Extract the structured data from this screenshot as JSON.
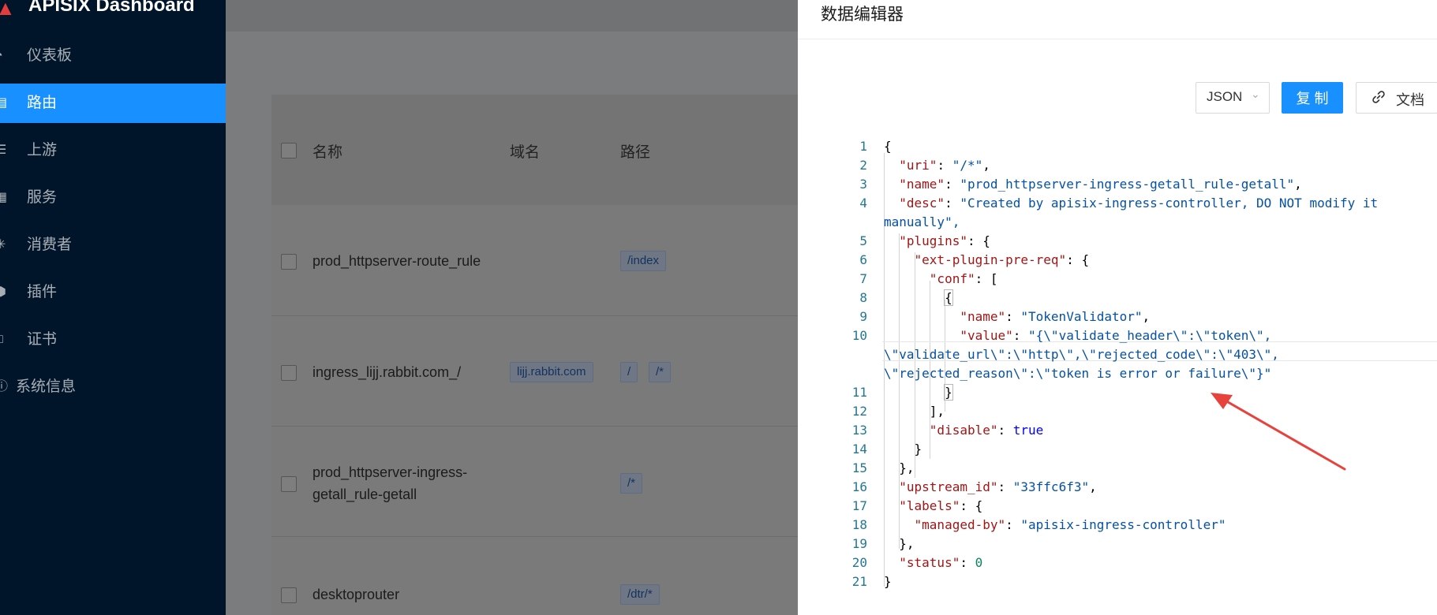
{
  "sidebar": {
    "brand": "APISIX Dashboard",
    "items": [
      {
        "label": "仪表板",
        "icon": "dashboard-icon"
      },
      {
        "label": "路由",
        "icon": "route-icon",
        "active": true
      },
      {
        "label": "上游",
        "icon": "upstream-icon"
      },
      {
        "label": "服务",
        "icon": "service-icon"
      },
      {
        "label": "消费者",
        "icon": "consumer-icon"
      },
      {
        "label": "插件",
        "icon": "plugin-icon"
      },
      {
        "label": "证书",
        "icon": "certificate-icon"
      },
      {
        "label": "系统信息",
        "icon": "info-icon"
      }
    ]
  },
  "table": {
    "columns": [
      "名称",
      "域名",
      "路径"
    ],
    "rows": [
      {
        "name": "prod_httpserver-route_rule",
        "host": "",
        "paths": [
          "/index"
        ]
      },
      {
        "name": "ingress_lijj.rabbit.com_/",
        "host": "lijj.rabbit.com",
        "paths": [
          "/",
          "/*"
        ]
      },
      {
        "name_line1": "prod_httpserver-ingress-",
        "name_line2": "getall_rule-getall",
        "host": "",
        "paths": [
          "/*"
        ]
      },
      {
        "name": "desktoprouter",
        "host": "",
        "paths": [
          "/dtr/*"
        ]
      }
    ]
  },
  "drawer": {
    "title": "数据编辑器",
    "format_select": "JSON",
    "copy_label": "复 制",
    "doc_label": "文档",
    "code_lines": [
      {
        "no": "1",
        "text": "{"
      },
      {
        "no": "2",
        "text": "  \"uri\": \"/*\","
      },
      {
        "no": "3",
        "text": "  \"name\": \"prod_httpserver-ingress-getall_rule-getall\","
      },
      {
        "no": "4",
        "text": "  \"desc\": \"Created by apisix-ingress-controller, DO NOT modify it"
      },
      {
        "no": "",
        "text": "manually\","
      },
      {
        "no": "5",
        "text": "  \"plugins\": {"
      },
      {
        "no": "6",
        "text": "    \"ext-plugin-pre-req\": {"
      },
      {
        "no": "7",
        "text": "      \"conf\": ["
      },
      {
        "no": "8",
        "text": "        {"
      },
      {
        "no": "9",
        "text": "          \"name\": \"TokenValidator\","
      },
      {
        "no": "10",
        "text": "          \"value\": \"{\\\"validate_header\\\":\\\"token\\\","
      },
      {
        "no": "",
        "text": "\\\"validate_url\\\":\\\"http\\\",\\\"rejected_code\\\":\\\"403\\\","
      },
      {
        "no": "",
        "text": "\\\"rejected_reason\\\":\\\"token is error or failure\\\"}\""
      },
      {
        "no": "11",
        "text": "        }"
      },
      {
        "no": "12",
        "text": "      ],"
      },
      {
        "no": "13",
        "text": "      \"disable\": true"
      },
      {
        "no": "14",
        "text": "    }"
      },
      {
        "no": "15",
        "text": "  },"
      },
      {
        "no": "16",
        "text": "  \"upstream_id\": \"33ffc6f3\","
      },
      {
        "no": "17",
        "text": "  \"labels\": {"
      },
      {
        "no": "18",
        "text": "    \"managed-by\": \"apisix-ingress-controller\""
      },
      {
        "no": "19",
        "text": "  },"
      },
      {
        "no": "20",
        "text": "  \"status\": 0"
      },
      {
        "no": "21",
        "text": "}"
      }
    ]
  },
  "colors": {
    "sidebar_bg": "#001529",
    "accent": "#1890ff",
    "annotation_arrow": "#e8423c"
  }
}
